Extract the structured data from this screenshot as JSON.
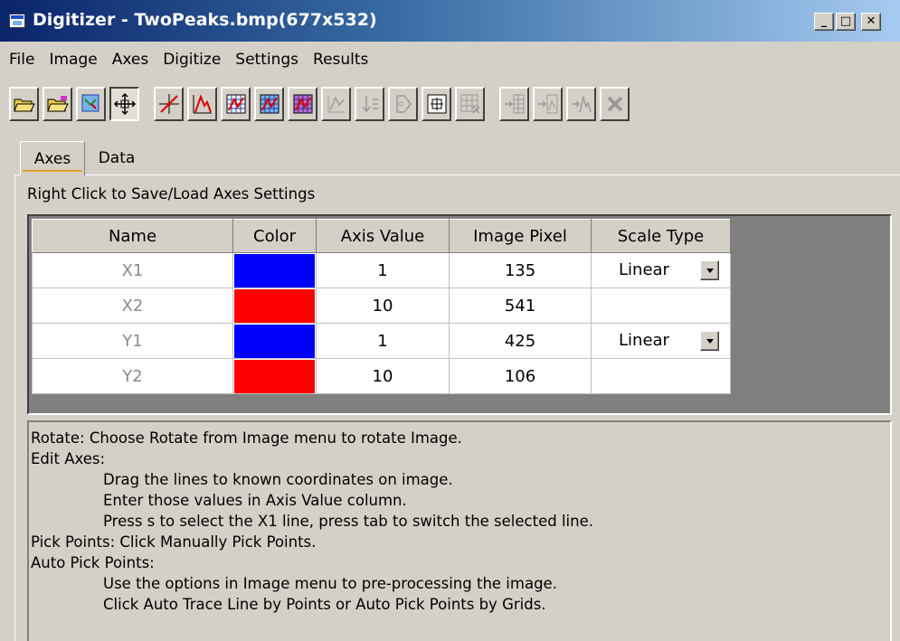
{
  "window": {
    "title": "Digitizer - TwoPeaks.bmp(677x532)",
    "controls": [
      "_",
      "□",
      "✕"
    ]
  },
  "menu": [
    "File",
    "Image",
    "Axes",
    "Digitize",
    "Settings",
    "Results"
  ],
  "toolbar": [
    {
      "icon": "open-folder-icon",
      "enabled": true
    },
    {
      "icon": "open-folder-magenta-icon",
      "enabled": true
    },
    {
      "icon": "rotate-image-icon",
      "enabled": true
    },
    {
      "icon": "edit-axes-icon",
      "enabled": true,
      "pressed": true
    },
    {
      "icon": "pick-points-icon",
      "enabled": true
    },
    {
      "icon": "auto-trace-icon",
      "enabled": true
    },
    {
      "icon": "auto-pick-grid-icon",
      "enabled": true
    },
    {
      "icon": "grid-blue-icon",
      "enabled": true
    },
    {
      "icon": "grid-purple-icon",
      "enabled": true
    },
    {
      "icon": "curve-icon",
      "enabled": false
    },
    {
      "icon": "sort-icon",
      "enabled": false
    },
    {
      "icon": "tag-icon",
      "enabled": false
    },
    {
      "icon": "zoom-fit-icon",
      "enabled": true
    },
    {
      "icon": "table-grid-icon",
      "enabled": false
    },
    {
      "icon": "insert-column-icon",
      "enabled": false
    },
    {
      "icon": "insert-chart-icon",
      "enabled": false
    },
    {
      "icon": "insert-peak-icon",
      "enabled": false
    },
    {
      "icon": "delete-icon",
      "enabled": false
    }
  ],
  "tabs": [
    "Axes",
    "Data"
  ],
  "hint": "Right Click to Save/Load Axes Settings",
  "grid": {
    "headers": [
      "Name",
      "Color",
      "Axis Value",
      "Image Pixel",
      "Scale Type"
    ],
    "rows": [
      {
        "name": "X1",
        "color": "#0000ff",
        "axis_value": "1",
        "image_pixel": "135",
        "scale_type": "Linear"
      },
      {
        "name": "X2",
        "color": "#ff0000",
        "axis_value": "10",
        "image_pixel": "541",
        "scale_type": ""
      },
      {
        "name": "Y1",
        "color": "#0000ff",
        "axis_value": "1",
        "image_pixel": "425",
        "scale_type": "Linear"
      },
      {
        "name": "Y2",
        "color": "#ff0000",
        "axis_value": "10",
        "image_pixel": "106",
        "scale_type": ""
      }
    ]
  },
  "instructions": [
    {
      "text": "Rotate: Choose Rotate from Image menu to rotate Image.",
      "indent": false
    },
    {
      "text": "Edit Axes:",
      "indent": false
    },
    {
      "text": "Drag the lines to known coordinates on image.",
      "indent": true
    },
    {
      "text": "Enter those values in Axis Value column.",
      "indent": true
    },
    {
      "text": "Press s to select the X1 line, press tab to switch the selected line.",
      "indent": true
    },
    {
      "text": "Pick Points: Click Manually Pick Points.",
      "indent": false
    },
    {
      "text": "Auto Pick Points:",
      "indent": false
    },
    {
      "text": "Use the options in Image menu to pre-processing the image.",
      "indent": true
    },
    {
      "text": "Click Auto Trace Line by Points or Auto Pick Points by Grids.",
      "indent": true
    }
  ]
}
